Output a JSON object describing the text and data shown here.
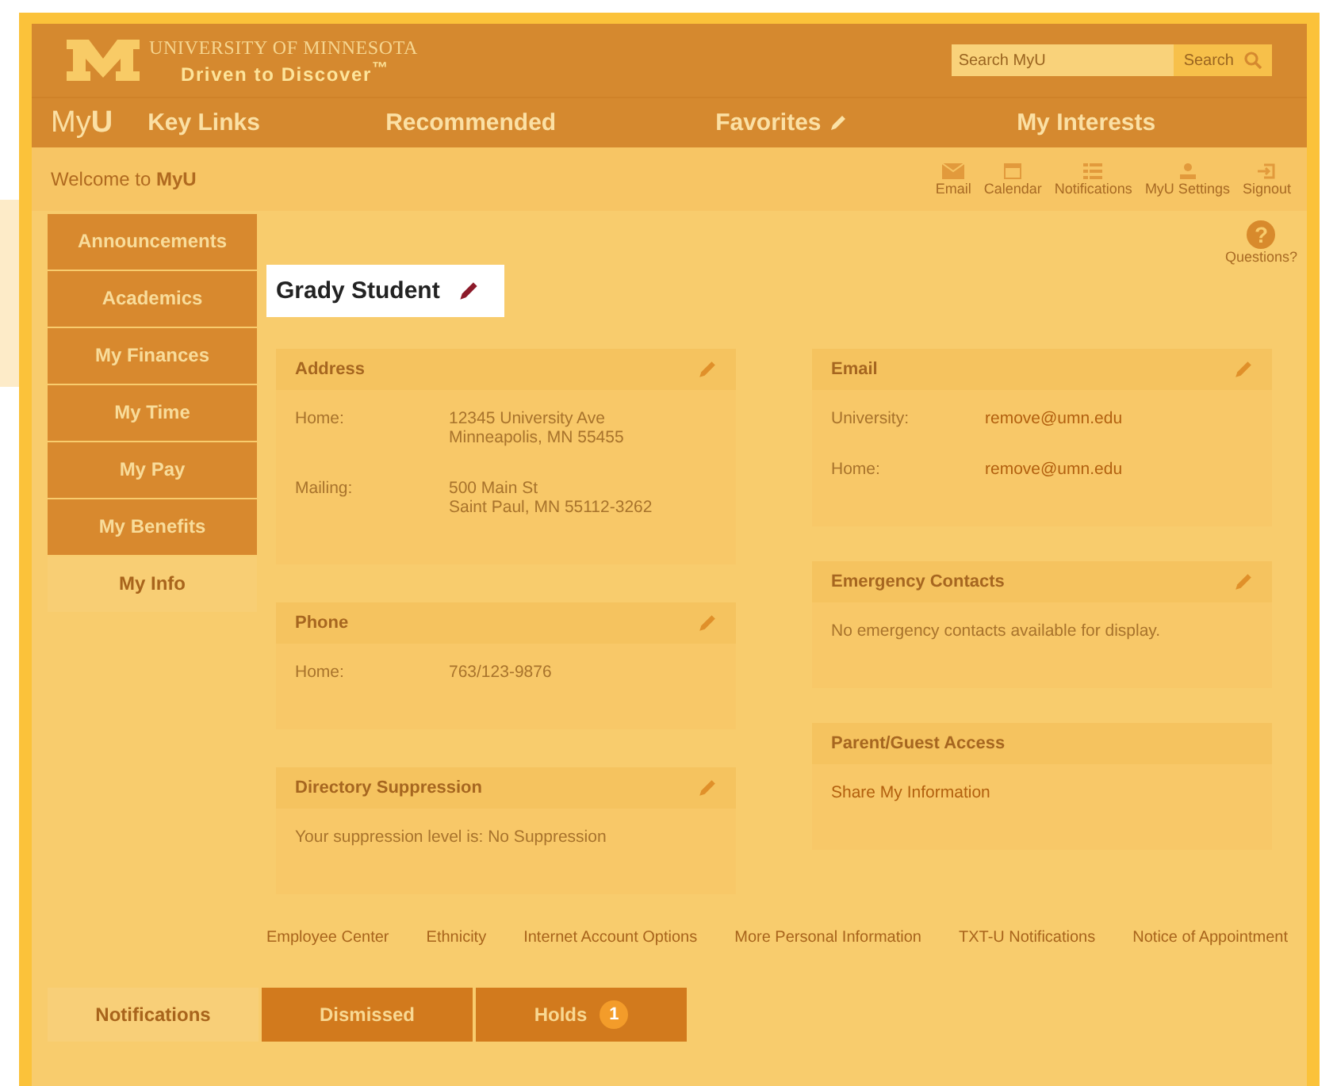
{
  "header": {
    "logo_line1": "UNIVERSITY OF MINNESOTA",
    "logo_line2": "Driven to Discover$^{™}$",
    "search": {
      "placeholder": "Search MyU",
      "button": "Search"
    }
  },
  "nav": {
    "brand": "My**U**",
    "items": [
      {
        "label": "Key Links",
        "editable": false
      },
      {
        "label": "Recommended",
        "editable": false
      },
      {
        "label": "Favorites",
        "editable": true
      },
      {
        "label": "My Interests",
        "editable": false
      }
    ]
  },
  "welcome": "Welcome to **MyU**",
  "toolbar": [
    {
      "label": "Email"
    },
    {
      "label": "Calendar"
    },
    {
      "label": "Notifications"
    },
    {
      "label": "MyU Settings"
    },
    {
      "label": "Signout"
    }
  ],
  "sidebar": {
    "items": [
      {
        "label": "Announcements",
        "selected": false
      },
      {
        "label": "Academics",
        "selected": false
      },
      {
        "label": "My Finances",
        "selected": false
      },
      {
        "label": "My Time",
        "selected": false
      },
      {
        "label": "My Pay",
        "selected": false
      },
      {
        "label": "My Benefits",
        "selected": false
      },
      {
        "label": "My Info",
        "selected": true
      }
    ]
  },
  "help": {
    "icon": "?",
    "label": "Questions?"
  },
  "profile": {
    "name": "Grady Student"
  },
  "columns": [
    [
      {
        "title": "Address",
        "editable": true,
        "rows": [
          {
            "label": "Home:",
            "value": [
              "12345 University Ave",
              "Minneapolis, MN 55455"
            ]
          },
          {
            "label": "Mailing:",
            "value": [
              "500 Main St",
              "Saint Paul, MN 55112-3262"
            ]
          }
        ]
      },
      {
        "title": "Phone",
        "editable": true,
        "rows": [
          {
            "label": "Home:",
            "value": [
              "763/123-9876"
            ]
          }
        ]
      },
      {
        "title": "Directory Suppression",
        "editable": true,
        "text": "Your suppression level is: No Suppression"
      }
    ],
    [
      {
        "title": "Email",
        "editable": true,
        "link_values": true,
        "rows": [
          {
            "label": "University:",
            "value": [
              "remove@umn.edu"
            ]
          },
          {
            "label": "Home:",
            "value": [
              "remove@umn.edu"
            ]
          }
        ]
      },
      {
        "title": "Emergency Contacts",
        "editable": true,
        "text": "No emergency contacts available for display."
      },
      {
        "title": "Parent/Guest Access",
        "editable": false,
        "link": "Share My Information"
      }
    ]
  ],
  "footer_links": [
    "Employee Center",
    "Ethnicity",
    "Internet Account Options",
    "More Personal Information",
    "TXT-U Notifications",
    "Notice of Appointment"
  ],
  "bottom_tabs": [
    {
      "label": "Notifications",
      "selected": true
    },
    {
      "label": "Dismissed",
      "selected": false
    },
    {
      "label": "Holds",
      "selected": false,
      "badge": "1"
    }
  ]
}
